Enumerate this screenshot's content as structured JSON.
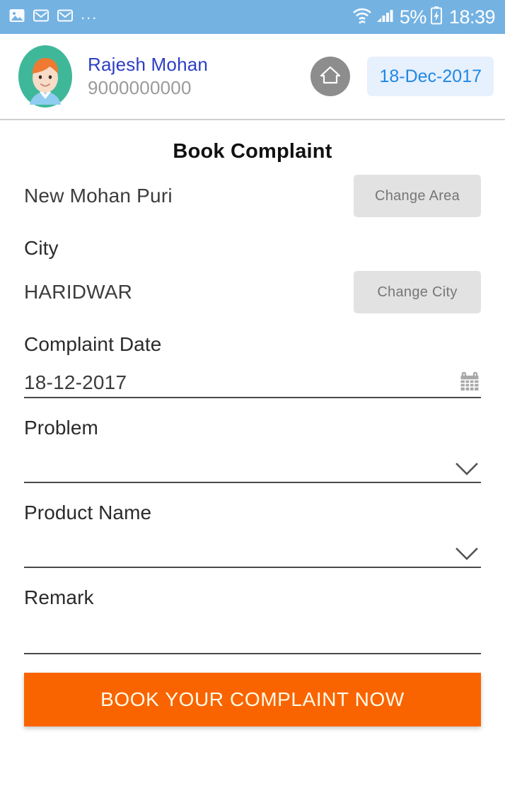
{
  "status_bar": {
    "background": "#74b2e2",
    "left_icons": [
      "image-icon",
      "gmail-icon",
      "gmail-icon"
    ],
    "overflow": "...",
    "right_icons": [
      "wifi-icon",
      "signal-icon",
      "battery-icon"
    ],
    "battery_percent": "5%",
    "clock": "18:39"
  },
  "header": {
    "avatar": "user-avatar",
    "user_name": "Rajesh Mohan",
    "user_phone": "9000000000",
    "home_icon": "home-icon",
    "date_chip": "18-Dec-2017",
    "name_color": "#2c3fc4",
    "chip_text_color": "#1e88e5",
    "chip_bg_color": "#e7f0fd"
  },
  "main": {
    "title": "Book Complaint",
    "area": {
      "value": "New Mohan Puri",
      "button_label": "Change Area"
    },
    "city": {
      "label": "City",
      "value": "HARIDWAR",
      "button_label": "Change City"
    },
    "complaint_date": {
      "label": "Complaint Date",
      "value": "18-12-2017",
      "icon": "calendar-icon"
    },
    "problem": {
      "label": "Problem",
      "value": "",
      "icon": "chevron-down-icon"
    },
    "product_name": {
      "label": "Product Name",
      "value": "",
      "icon": "chevron-down-icon"
    },
    "remark": {
      "label": "Remark",
      "value": "",
      "placeholder": ""
    },
    "submit_label": "BOOK YOUR COMPLAINT NOW",
    "submit_color": "#fa6400"
  }
}
